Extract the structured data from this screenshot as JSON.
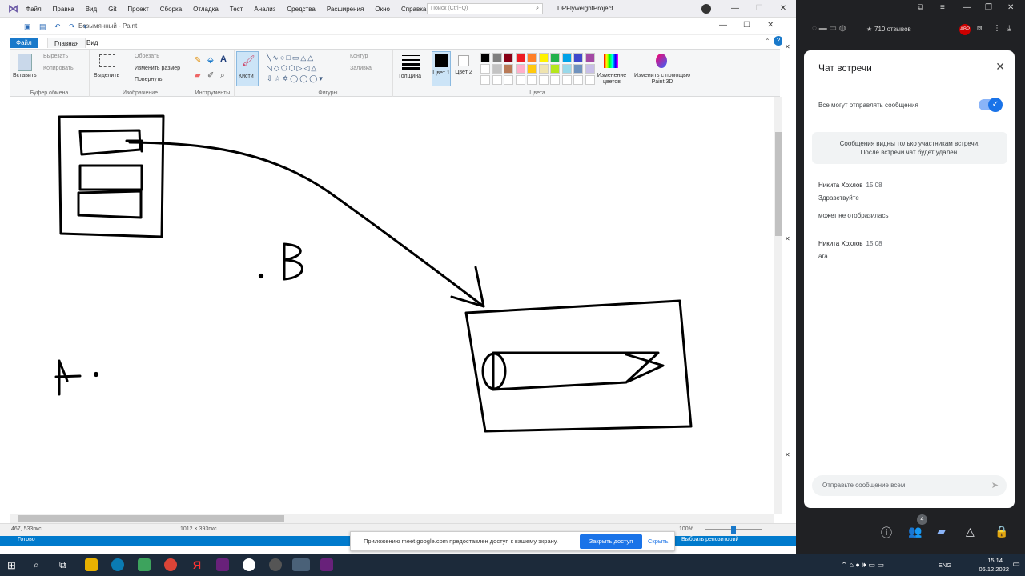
{
  "vs": {
    "menu": [
      "Файл",
      "Правка",
      "Вид",
      "Git",
      "Проект",
      "Сборка",
      "Отладка",
      "Тест",
      "Анализ",
      "Средства",
      "Расширения",
      "Окно",
      "Справка"
    ],
    "search_placeholder": "Поиск (Ctrl+Q)",
    "project": "DPFlyweightProject",
    "status_left": "Готово",
    "status_repo": "Выбрать репозиторий"
  },
  "paint": {
    "title": "Безымянный - Paint",
    "tabs": {
      "file": "Файл",
      "home": "Главная",
      "view": "Вид"
    },
    "clipboard": {
      "paste": "Вставить",
      "cut": "Вырезать",
      "copy": "Копировать",
      "label": "Буфер обмена"
    },
    "image": {
      "select": "Выделить",
      "crop": "Обрезать",
      "resize": "Изменить размер",
      "rotate": "Повернуть",
      "label": "Изображение"
    },
    "tools_label": "Инструменты",
    "brushes": "Кисти",
    "shapes": {
      "outline": "Контур",
      "fill": "Заливка",
      "label": "Фигуры"
    },
    "size": "Толщина",
    "color1": "Цвет 1",
    "color2": "Цвет 2",
    "edit_colors": "Изменение цветов",
    "paint3d": "Изменить с помощью Paint 3D",
    "colors_label": "Цвета",
    "palette_row1": [
      "#000000",
      "#7f7f7f",
      "#880015",
      "#ed1c24",
      "#ff7f27",
      "#fff200",
      "#22b14c",
      "#00a2e8",
      "#3f48cc",
      "#a349a4"
    ],
    "palette_row2": [
      "#ffffff",
      "#c3c3c3",
      "#b97a57",
      "#ffaec9",
      "#ffc90e",
      "#efe4b0",
      "#b5e61d",
      "#99d9ea",
      "#7092be",
      "#c8bfe7"
    ],
    "status_pos": "467, 533пкс",
    "status_size": "1012 × 393пкс",
    "zoom": "100%",
    "canvas_text_b": "B",
    "canvas_text_a": "A"
  },
  "share_bar": {
    "message": "Приложению meet.google.com предоставлен доступ к вашему экрану.",
    "stop": "Закрыть доступ",
    "hide": "Скрыть"
  },
  "browser": {
    "bookmark": "710 отзывов"
  },
  "chat": {
    "title": "Чат встречи",
    "toggle_label": "Все могут отправлять сообщения",
    "notice_line1": "Сообщения видны только участникам встречи.",
    "notice_line2": "После встречи чат будет удален.",
    "messages": [
      {
        "author": "Никита Хохлов",
        "time": "15:08",
        "lines": [
          "Здравствуйте",
          "может не отобразилась"
        ]
      },
      {
        "author": "Никита Хохлов",
        "time": "15:08",
        "lines": [
          "ага"
        ]
      }
    ],
    "input_placeholder": "Отправьте сообщение всем",
    "participants": "4"
  },
  "taskbar": {
    "lang": "ENG",
    "time": "15:14",
    "date": "06.12.2022"
  }
}
